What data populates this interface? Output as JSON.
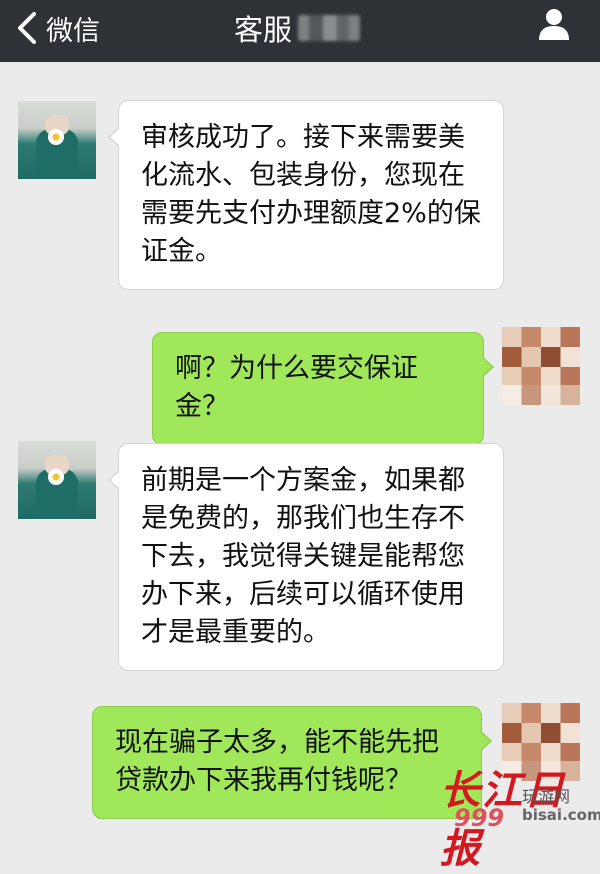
{
  "topbar": {
    "back_label": "微信",
    "title": "客服",
    "icons": {
      "back": "chevron-left-icon",
      "profile": "user-icon"
    }
  },
  "messages": [
    {
      "sender": "agent",
      "text": "审核成功了。接下来需要美化流水、包装身份，您现在需要先支付办理额度2%的保证金。"
    },
    {
      "sender": "user",
      "text": "啊？为什么要交保证金？"
    },
    {
      "sender": "agent",
      "text": "前期是一个方案金，如果都是免费的，那我们也生存不下去，我觉得关键是能帮您办下来，后续可以循环使用才是最重要的。"
    },
    {
      "sender": "user",
      "text": "现在骗子太多，能不能先把贷款办下来我再付钱呢？"
    }
  ],
  "watermark": {
    "main": "长江日报",
    "site_name": "玩游网",
    "site_url": "bisai.com"
  },
  "colors": {
    "topbar": "#2e3237",
    "background": "#ebebeb",
    "incoming_bubble": "#ffffff",
    "outgoing_bubble": "#a0e75a",
    "watermark_red": "#d4181f"
  }
}
